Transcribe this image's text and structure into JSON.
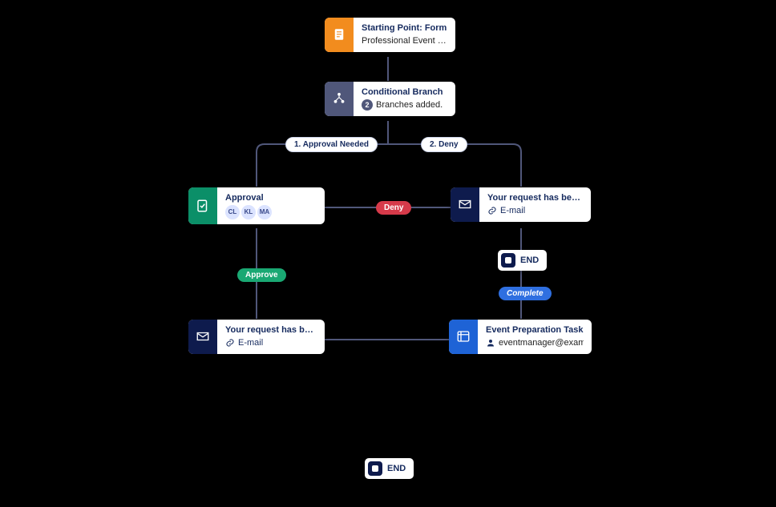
{
  "nodes": {
    "start": {
      "title": "Starting Point: Form",
      "subtitle": "Professional Event Registr...",
      "accent": "#f28c1e"
    },
    "branch": {
      "title": "Conditional Branch",
      "count": "2",
      "count_suffix": "Branches added.",
      "accent": "#50577a"
    },
    "approval": {
      "title": "Approval",
      "avatars": [
        "CL",
        "KL",
        "MA"
      ],
      "accent": "#0b8f68"
    },
    "denied_email": {
      "title": "Your request has been denied.",
      "link_text": "E-mail",
      "accent": "#0e1b4d"
    },
    "approved_email": {
      "title": "Your request has been appro...",
      "link_text": "E-mail",
      "accent": "#0e1b4d"
    },
    "task": {
      "title": "Event Preparation Task",
      "assignee": "eventmanager@exam...",
      "accent": "#1e63d6"
    }
  },
  "branch_labels": {
    "left": "1. Approval Needed",
    "right": "2. Deny"
  },
  "edge_labels": {
    "deny": "Deny",
    "approve": "Approve",
    "complete": "Complete"
  },
  "end_label": "END",
  "connector_color": "#50577a"
}
